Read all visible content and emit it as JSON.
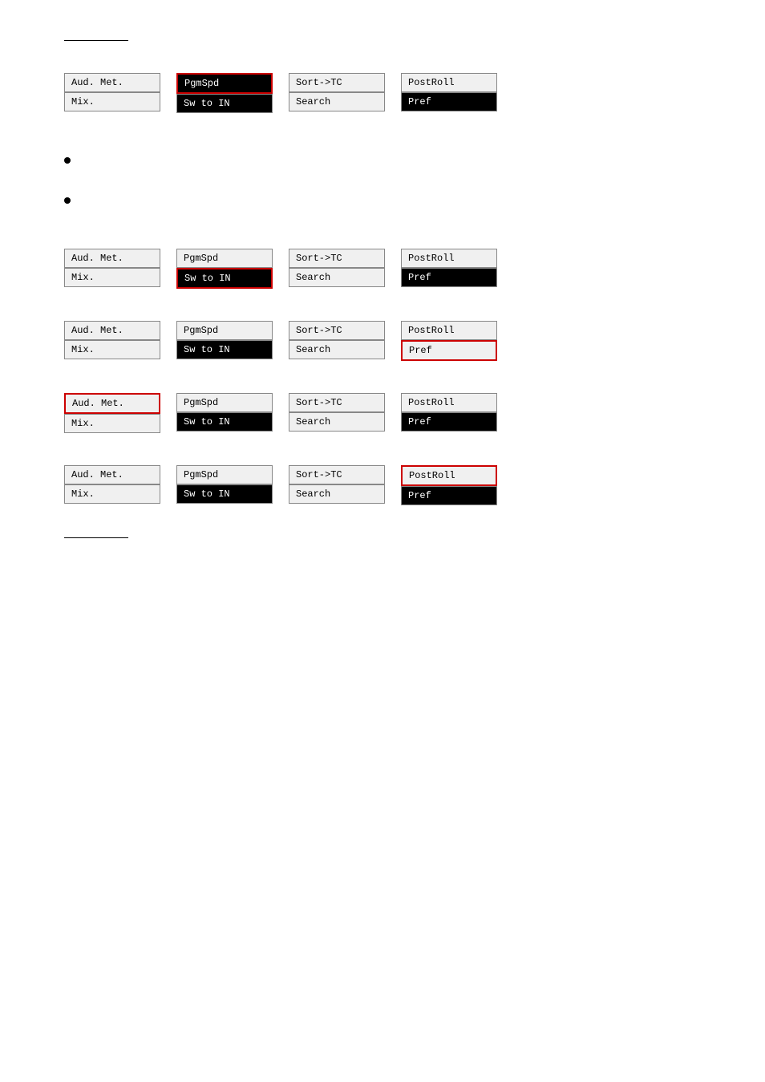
{
  "page": {
    "sections": [
      {
        "id": "section1",
        "buttons": [
          {
            "id": "aud-met-1",
            "top": "Aud. Met.",
            "bottom": "Mix.",
            "top_style": "normal",
            "bottom_style": "normal"
          },
          {
            "id": "pgmspd-1",
            "top": "PgmSpd",
            "bottom": "Sw to IN",
            "top_style": "bg-red-border",
            "bottom_style": "bg-black"
          },
          {
            "id": "sort-tc-1",
            "top": "Sort->TC",
            "bottom": "Search",
            "top_style": "normal",
            "bottom_style": "normal"
          },
          {
            "id": "postroll-1",
            "top": "PostRoll",
            "bottom": "Pref",
            "top_style": "normal",
            "bottom_style": "bg-black"
          }
        ]
      },
      {
        "id": "section2",
        "bullets": [
          {
            "id": "bullet1",
            "text": ""
          },
          {
            "id": "bullet2",
            "text": ""
          }
        ]
      },
      {
        "id": "section3",
        "buttons": [
          {
            "id": "aud-met-3",
            "top": "Aud. Met.",
            "bottom": "Mix.",
            "top_style": "normal",
            "bottom_style": "normal"
          },
          {
            "id": "pgmspd-3",
            "top": "PgmSpd",
            "bottom": "Sw to IN",
            "top_style": "normal",
            "bottom_style": "bg-red-border"
          },
          {
            "id": "sort-tc-3",
            "top": "Sort->TC",
            "bottom": "Search",
            "top_style": "normal",
            "bottom_style": "normal"
          },
          {
            "id": "postroll-3",
            "top": "PostRoll",
            "bottom": "Pref",
            "top_style": "normal",
            "bottom_style": "bg-black"
          }
        ]
      },
      {
        "id": "section4",
        "buttons": [
          {
            "id": "aud-met-4",
            "top": "Aud. Met.",
            "bottom": "Mix.",
            "top_style": "normal",
            "bottom_style": "normal"
          },
          {
            "id": "pgmspd-4",
            "top": "PgmSpd",
            "bottom": "Sw to IN",
            "top_style": "normal",
            "bottom_style": "bg-black"
          },
          {
            "id": "sort-tc-4",
            "top": "Sort->TC",
            "bottom": "Search",
            "top_style": "normal",
            "bottom_style": "normal"
          },
          {
            "id": "postroll-4",
            "top": "PostRoll",
            "bottom": "Pref",
            "top_style": "normal",
            "bottom_style": "outline-red"
          }
        ]
      },
      {
        "id": "section5",
        "buttons": [
          {
            "id": "aud-met-5",
            "top": "Aud. Met.",
            "bottom": "Mix.",
            "top_style": "outline-red",
            "bottom_style": "normal"
          },
          {
            "id": "pgmspd-5",
            "top": "PgmSpd",
            "bottom": "Sw to IN",
            "top_style": "normal",
            "bottom_style": "bg-black"
          },
          {
            "id": "sort-tc-5",
            "top": "Sort->TC",
            "bottom": "Search",
            "top_style": "normal",
            "bottom_style": "normal"
          },
          {
            "id": "postroll-5",
            "top": "PostRoll",
            "bottom": "Pref",
            "top_style": "normal",
            "bottom_style": "bg-black"
          }
        ]
      },
      {
        "id": "section6",
        "buttons": [
          {
            "id": "aud-met-6",
            "top": "Aud. Met.",
            "bottom": "Mix.",
            "top_style": "normal",
            "bottom_style": "normal"
          },
          {
            "id": "pgmspd-6",
            "top": "PgmSpd",
            "bottom": "Sw to IN",
            "top_style": "normal",
            "bottom_style": "bg-black"
          },
          {
            "id": "sort-tc-6",
            "top": "Sort->TC",
            "bottom": "Search",
            "top_style": "normal",
            "bottom_style": "normal"
          },
          {
            "id": "postroll-6",
            "top": "PostRoll",
            "bottom": "Pref",
            "top_style": "outline-red",
            "bottom_style": "bg-black"
          }
        ]
      }
    ]
  }
}
